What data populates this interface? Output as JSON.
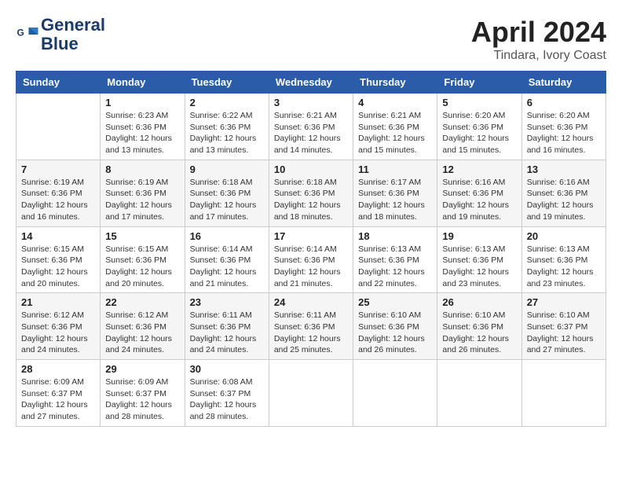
{
  "header": {
    "logo_line1": "General",
    "logo_line2": "Blue",
    "title": "April 2024",
    "subtitle": "Tindara, Ivory Coast"
  },
  "calendar": {
    "days_of_week": [
      "Sunday",
      "Monday",
      "Tuesday",
      "Wednesday",
      "Thursday",
      "Friday",
      "Saturday"
    ],
    "weeks": [
      [
        {
          "day": "",
          "info": ""
        },
        {
          "day": "1",
          "info": "Sunrise: 6:23 AM\nSunset: 6:36 PM\nDaylight: 12 hours and 13 minutes."
        },
        {
          "day": "2",
          "info": "Sunrise: 6:22 AM\nSunset: 6:36 PM\nDaylight: 12 hours and 13 minutes."
        },
        {
          "day": "3",
          "info": "Sunrise: 6:21 AM\nSunset: 6:36 PM\nDaylight: 12 hours and 14 minutes."
        },
        {
          "day": "4",
          "info": "Sunrise: 6:21 AM\nSunset: 6:36 PM\nDaylight: 12 hours and 15 minutes."
        },
        {
          "day": "5",
          "info": "Sunrise: 6:20 AM\nSunset: 6:36 PM\nDaylight: 12 hours and 15 minutes."
        },
        {
          "day": "6",
          "info": "Sunrise: 6:20 AM\nSunset: 6:36 PM\nDaylight: 12 hours and 16 minutes."
        }
      ],
      [
        {
          "day": "7",
          "info": "Sunrise: 6:19 AM\nSunset: 6:36 PM\nDaylight: 12 hours and 16 minutes."
        },
        {
          "day": "8",
          "info": "Sunrise: 6:19 AM\nSunset: 6:36 PM\nDaylight: 12 hours and 17 minutes."
        },
        {
          "day": "9",
          "info": "Sunrise: 6:18 AM\nSunset: 6:36 PM\nDaylight: 12 hours and 17 minutes."
        },
        {
          "day": "10",
          "info": "Sunrise: 6:18 AM\nSunset: 6:36 PM\nDaylight: 12 hours and 18 minutes."
        },
        {
          "day": "11",
          "info": "Sunrise: 6:17 AM\nSunset: 6:36 PM\nDaylight: 12 hours and 18 minutes."
        },
        {
          "day": "12",
          "info": "Sunrise: 6:16 AM\nSunset: 6:36 PM\nDaylight: 12 hours and 19 minutes."
        },
        {
          "day": "13",
          "info": "Sunrise: 6:16 AM\nSunset: 6:36 PM\nDaylight: 12 hours and 19 minutes."
        }
      ],
      [
        {
          "day": "14",
          "info": "Sunrise: 6:15 AM\nSunset: 6:36 PM\nDaylight: 12 hours and 20 minutes."
        },
        {
          "day": "15",
          "info": "Sunrise: 6:15 AM\nSunset: 6:36 PM\nDaylight: 12 hours and 20 minutes."
        },
        {
          "day": "16",
          "info": "Sunrise: 6:14 AM\nSunset: 6:36 PM\nDaylight: 12 hours and 21 minutes."
        },
        {
          "day": "17",
          "info": "Sunrise: 6:14 AM\nSunset: 6:36 PM\nDaylight: 12 hours and 21 minutes."
        },
        {
          "day": "18",
          "info": "Sunrise: 6:13 AM\nSunset: 6:36 PM\nDaylight: 12 hours and 22 minutes."
        },
        {
          "day": "19",
          "info": "Sunrise: 6:13 AM\nSunset: 6:36 PM\nDaylight: 12 hours and 23 minutes."
        },
        {
          "day": "20",
          "info": "Sunrise: 6:13 AM\nSunset: 6:36 PM\nDaylight: 12 hours and 23 minutes."
        }
      ],
      [
        {
          "day": "21",
          "info": "Sunrise: 6:12 AM\nSunset: 6:36 PM\nDaylight: 12 hours and 24 minutes."
        },
        {
          "day": "22",
          "info": "Sunrise: 6:12 AM\nSunset: 6:36 PM\nDaylight: 12 hours and 24 minutes."
        },
        {
          "day": "23",
          "info": "Sunrise: 6:11 AM\nSunset: 6:36 PM\nDaylight: 12 hours and 24 minutes."
        },
        {
          "day": "24",
          "info": "Sunrise: 6:11 AM\nSunset: 6:36 PM\nDaylight: 12 hours and 25 minutes."
        },
        {
          "day": "25",
          "info": "Sunrise: 6:10 AM\nSunset: 6:36 PM\nDaylight: 12 hours and 26 minutes."
        },
        {
          "day": "26",
          "info": "Sunrise: 6:10 AM\nSunset: 6:36 PM\nDaylight: 12 hours and 26 minutes."
        },
        {
          "day": "27",
          "info": "Sunrise: 6:10 AM\nSunset: 6:37 PM\nDaylight: 12 hours and 27 minutes."
        }
      ],
      [
        {
          "day": "28",
          "info": "Sunrise: 6:09 AM\nSunset: 6:37 PM\nDaylight: 12 hours and 27 minutes."
        },
        {
          "day": "29",
          "info": "Sunrise: 6:09 AM\nSunset: 6:37 PM\nDaylight: 12 hours and 28 minutes."
        },
        {
          "day": "30",
          "info": "Sunrise: 6:08 AM\nSunset: 6:37 PM\nDaylight: 12 hours and 28 minutes."
        },
        {
          "day": "",
          "info": ""
        },
        {
          "day": "",
          "info": ""
        },
        {
          "day": "",
          "info": ""
        },
        {
          "day": "",
          "info": ""
        }
      ]
    ]
  }
}
